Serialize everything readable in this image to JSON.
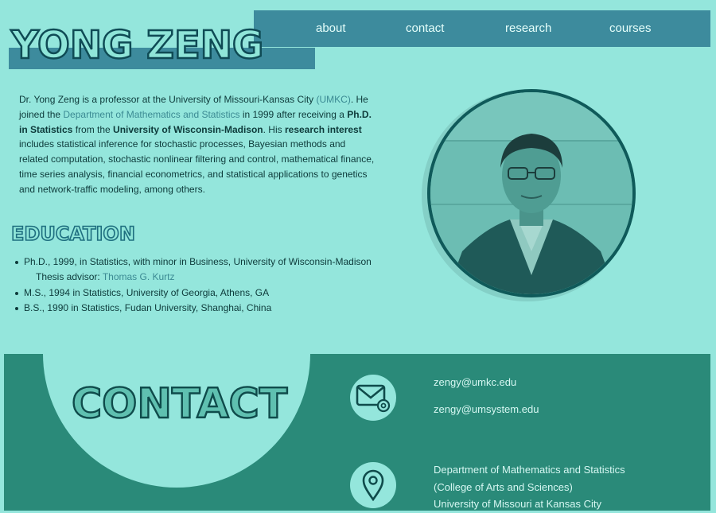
{
  "nav": {
    "about": "about",
    "contact": "contact",
    "research": "research",
    "courses": "courses"
  },
  "header": {
    "name": "YONG ZENG"
  },
  "bio": {
    "p1": "Dr. Yong Zeng is a professor at the University of Missouri-Kansas City ",
    "umkc": "(UMKC)",
    "p2": ". He joined the ",
    "dept_link": "Department of Mathematics and Statistics",
    "p3": " in 1999 after receiving a ",
    "phd": "Ph.D. in Statistics",
    "p4": " from the ",
    "uw": "University of Wisconsin-Madison",
    "p5": ". His ",
    "ri": "research interest",
    "p6": " includes statistical inference for stochastic processes, Bayesian methods and related computation, stochastic nonlinear filtering and control, mathematical finance, time series analysis, financial econometrics, and statistical applications to genetics and network-traffic modeling, among others."
  },
  "education": {
    "title": "EDUCATION",
    "phd": "Ph.D., 1999, in Statistics, with minor in Business, University of Wisconsin-Madison",
    "advisor_label": "Thesis advisor: ",
    "advisor_name": "Thomas G. Kurtz",
    "ms": "M.S., 1994 in Statistics, University of Georgia, Athens, GA",
    "bs": "B.S., 1990 in Statistics, Fudan University, Shanghai, China"
  },
  "contact": {
    "title": "CONTACT",
    "email1": "zengy@umkc.edu",
    "email2": "zengy@umsystem.edu",
    "addr1": "Department of Mathematics and Statistics",
    "addr2": "(College of Arts and Sciences)",
    "addr3": "University of Missouri at Kansas City"
  },
  "icons": {
    "email": "envelope-at-icon",
    "location": "location-pin-icon"
  },
  "colors": {
    "background": "#94e6dc",
    "nav": "#3d8b9d",
    "contact_section": "#2a8a79",
    "link": "#3b8a93"
  }
}
